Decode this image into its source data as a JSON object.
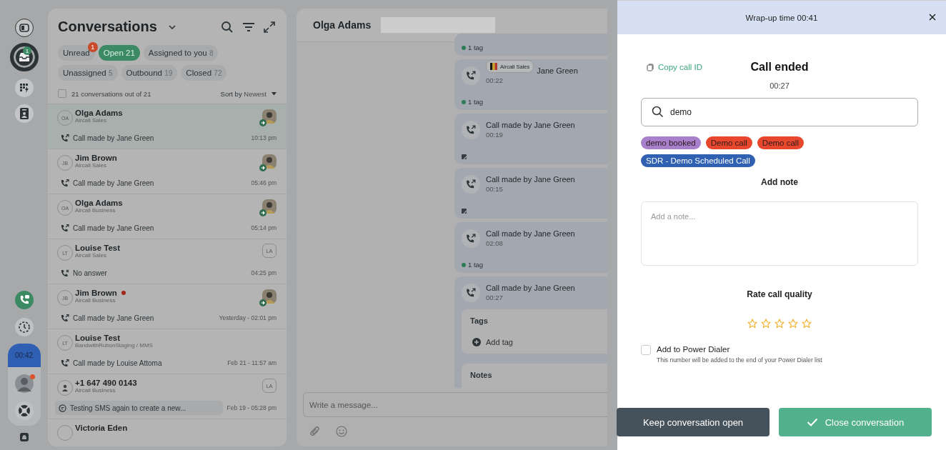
{
  "rail": {
    "top_items": [
      {
        "kind": "toggle",
        "selected": false
      },
      {
        "kind": "inbox",
        "selected": true,
        "badge": "1"
      },
      {
        "kind": "dialpad",
        "selected": false
      },
      {
        "kind": "contacts",
        "selected": false
      }
    ],
    "timer": "00:42",
    "avatar_dot": true
  },
  "conversations": {
    "title": "Conversations",
    "filters": [
      {
        "label": "Unread",
        "badge": "1",
        "selected": false
      },
      {
        "label": "Open",
        "count": "21",
        "selected": true
      },
      {
        "label": "Assigned to you",
        "count": "8",
        "selected": false
      },
      {
        "label": "Unassigned",
        "count": "5",
        "selected": false
      },
      {
        "label": "Outbound",
        "count": "19",
        "selected": false
      },
      {
        "label": "Closed",
        "count": "72",
        "selected": false
      }
    ],
    "select_all": {
      "checked": false,
      "label": "21 conversations out of 21"
    },
    "sort": {
      "label": "Sort by",
      "value": "Newest"
    },
    "items": [
      {
        "initials": "OA",
        "name": "Olga Adams",
        "source": "Aircall Sales",
        "unread": false,
        "assignee": {
          "kind": "photo"
        },
        "preview": {
          "kind": "call",
          "text": "Call made by Jane Green"
        },
        "time": "10:13 pm",
        "selected": true
      },
      {
        "initials": "JB",
        "name": "Jim Brown",
        "source": "Aircall Sales",
        "unread": false,
        "assignee": {
          "kind": "photo"
        },
        "preview": {
          "kind": "call",
          "text": "Call made by Jane Green"
        },
        "time": "05:46 pm",
        "selected": false
      },
      {
        "initials": "OA",
        "name": "Olga Adams",
        "source": "Aircall Business",
        "unread": false,
        "assignee": {
          "kind": "photo"
        },
        "preview": {
          "kind": "call",
          "text": "Call made by Jane Green"
        },
        "time": "05:14 pm",
        "selected": false
      },
      {
        "initials": "LT",
        "name": "Louise Test",
        "source": "Aircall Sales",
        "unread": false,
        "assignee": {
          "kind": "initials",
          "initials": "LA"
        },
        "preview": {
          "kind": "missed",
          "text": "No answer"
        },
        "time": "04:25 pm",
        "selected": false
      },
      {
        "initials": "JB",
        "name": "Jim Brown",
        "source": "Aircall Business",
        "unread": true,
        "assignee": {
          "kind": "photo"
        },
        "preview": {
          "kind": "call",
          "text": "Call made by Jane Green"
        },
        "time": "Yesterday - 02:01 pm",
        "selected": false
      },
      {
        "initials": "LT",
        "name": "Louise Test",
        "source": "BandwithRubonStaging / MMS",
        "unread": false,
        "assignee": {
          "kind": "none"
        },
        "preview": {
          "kind": "call",
          "text": "Call made by Louise Attoma"
        },
        "time": "Feb 21 - 11:57 am",
        "selected": false
      },
      {
        "name": "+1 647 490 0143",
        "source": "Aircall Business",
        "unread": false,
        "assignee": {
          "kind": "initials",
          "initials": "LA"
        },
        "preview": {
          "kind": "sms",
          "text": "Testing SMS again to create a new..."
        },
        "time": "Feb 19 - 05:28 pm",
        "selected": false
      },
      {
        "name": "Victoria Eden",
        "unread": false,
        "assignee": {
          "kind": "none"
        },
        "selected": false
      }
    ]
  },
  "chat": {
    "contact_name": "Olga Adams",
    "cards": [
      {
        "kind": "partial",
        "footer": {
          "kind": "tag",
          "text": "1 tag"
        }
      },
      {
        "kind": "call",
        "tooltip": "Aircall Sales",
        "title": "Jane Green",
        "duration": "00:22",
        "footer": {
          "kind": "tag",
          "text": "1 tag"
        }
      },
      {
        "kind": "call",
        "title": "Call made by Jane Green",
        "duration": "00:19",
        "footer": {
          "kind": "note"
        }
      },
      {
        "kind": "call",
        "title": "Call made by Jane Green",
        "duration": "00:15",
        "footer": {
          "kind": "note"
        }
      },
      {
        "kind": "call",
        "title": "Call made by Jane Green",
        "duration": "02:08",
        "footer": {
          "kind": "tag",
          "text": "1 tag"
        }
      },
      {
        "kind": "expanded",
        "title": "Call made by Jane Green",
        "duration": "00:27",
        "footer": {
          "kind": "sections",
          "tags_title": "Tags",
          "add_tag": "Add tag",
          "notes_title": "Notes"
        }
      }
    ],
    "composer": {
      "placeholder": "Write a message..."
    }
  },
  "wrapup": {
    "header": "Wrap-up time 00:41",
    "copy_call_id": "Copy call ID",
    "title": "Call ended",
    "duration": "00:27",
    "tag_search": {
      "value": "demo"
    },
    "tags": [
      {
        "label": "demo booked",
        "color": "#a77fcb"
      },
      {
        "label": "Demo call",
        "color": "#e8472d"
      },
      {
        "label": "Demo call",
        "color": "#e8472d"
      },
      {
        "label": "SDR - Demo Scheduled Call",
        "color": "#2f60b2"
      }
    ],
    "note_title": "Add note",
    "note": {
      "placeholder": "Add a note..."
    },
    "rate_title": "Rate call quality",
    "stars": 0,
    "power_dialer": {
      "checked": false,
      "label": "Add to Power Dialer",
      "hint": "This number will be added to the end of your Power Dialer list"
    },
    "buttons": [
      {
        "kind": "secondary",
        "label": "Keep conversation open"
      },
      {
        "kind": "primary",
        "label": "Close conversation"
      }
    ]
  }
}
